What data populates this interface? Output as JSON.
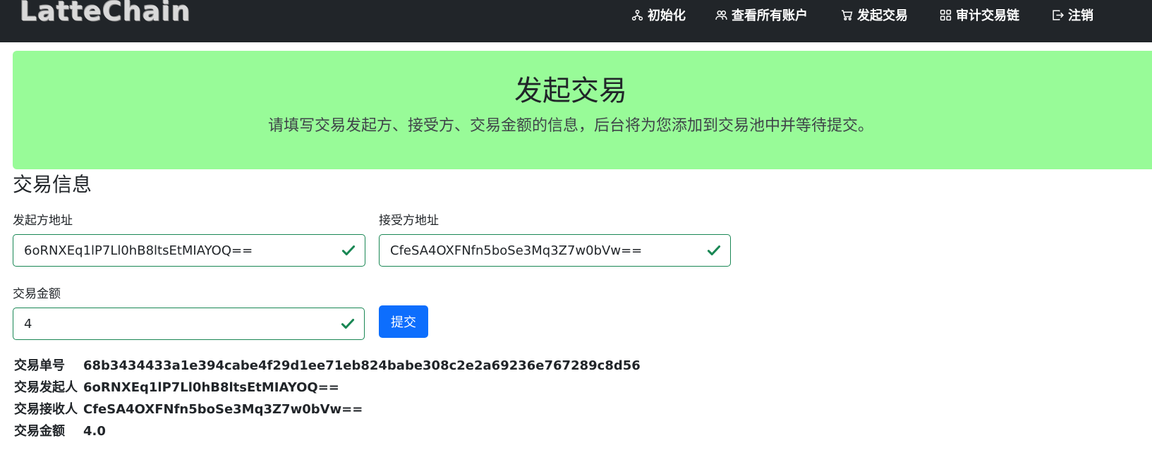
{
  "navbar": {
    "brand": "LatteChain",
    "items": [
      {
        "label": "初始化",
        "icon": "diagram-icon"
      },
      {
        "label": "查看所有账户",
        "icon": "people-icon"
      },
      {
        "label": "发起交易",
        "icon": "cart-icon"
      },
      {
        "label": "审计交易链",
        "icon": "grid-icon"
      },
      {
        "label": "注销",
        "icon": "logout-icon"
      }
    ]
  },
  "hero": {
    "title": "发起交易",
    "subtitle": "请填写交易发起方、接受方、交易金额的信息，后台将为您添加到交易池中并等待提交。"
  },
  "form": {
    "section_title": "交易信息",
    "sender_label": "发起方地址",
    "sender_value": "6oRNXEq1lP7Ll0hB8ltsEtMIAYOQ==",
    "receiver_label": "接受方地址",
    "receiver_value": "CfeSA4OXFNfn5boSe3Mq3Z7w0bVw==",
    "amount_label": "交易金额",
    "amount_value": "4",
    "submit_label": "提交"
  },
  "result": {
    "id_label": "交易单号",
    "id_value": "68b3434433a1e394cabe4f29d1ee71eb824babe308c2e2a69236e767289c8d56",
    "sender_label": "交易发起人",
    "sender_value": "6oRNXEq1lP7Ll0hB8ltsEtMIAYOQ==",
    "receiver_label": "交易接收人",
    "receiver_value": "CfeSA4OXFNfn5boSe3Mq3Z7w0bVw==",
    "amount_label": "交易金额",
    "amount_value": "4.0"
  },
  "colors": {
    "navbar": "#212529",
    "hero": "#98fb98",
    "valid": "#198754",
    "primary": "#0d6efd"
  }
}
